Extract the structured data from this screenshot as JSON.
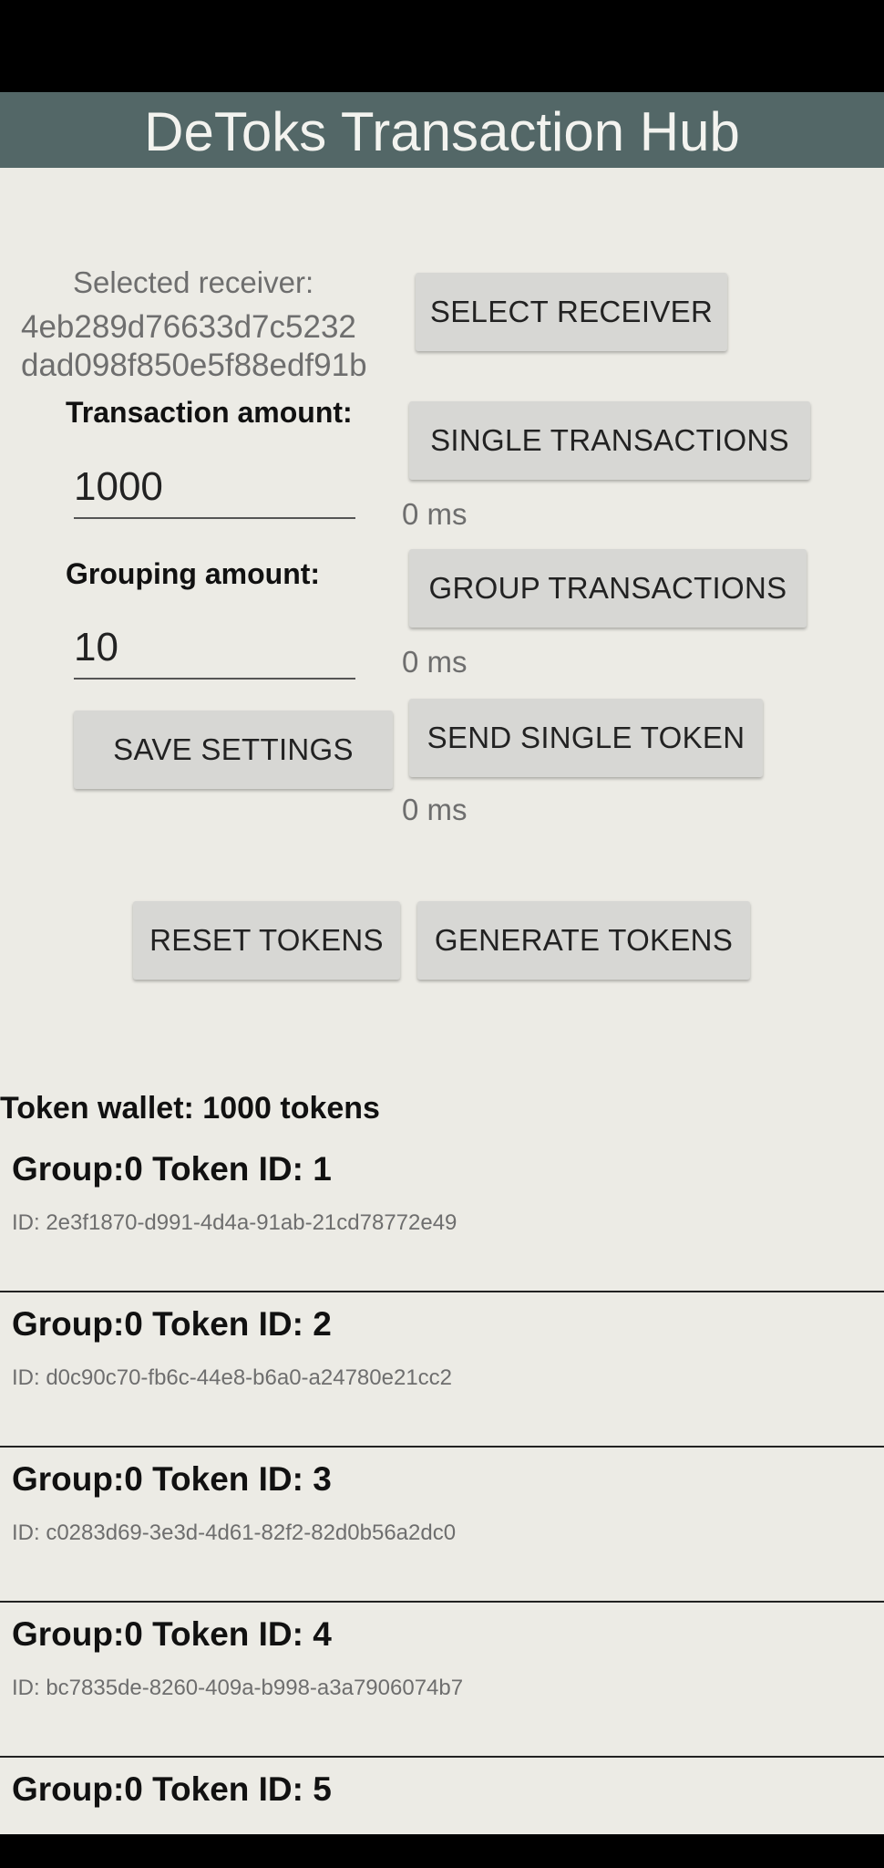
{
  "app": {
    "title": "DeToks Transaction Hub"
  },
  "receiver": {
    "label": "Selected receiver:",
    "line1": "4eb289d76633d7c5232",
    "line2": "dad098f850e5f88edf91b",
    "select_button": "SELECT RECEIVER"
  },
  "transaction": {
    "label": "Transaction amount:",
    "value": "1000",
    "button": "SINGLE TRANSACTIONS",
    "time": "0 ms"
  },
  "grouping": {
    "label": "Grouping amount:",
    "value": "10",
    "button": "GROUP TRANSACTIONS",
    "time": "0 ms"
  },
  "save_button": "SAVE SETTINGS",
  "single_token": {
    "button": "SEND SINGLE TOKEN",
    "time": "0 ms"
  },
  "reset_button": "RESET TOKENS",
  "generate_button": "GENERATE TOKENS",
  "wallet": {
    "title": "Token wallet: 1000 tokens",
    "tokens": [
      {
        "title": "Group:0 Token ID: 1",
        "id": "ID: 2e3f1870-d991-4d4a-91ab-21cd78772e49"
      },
      {
        "title": "Group:0 Token ID: 2",
        "id": "ID: d0c90c70-fb6c-44e8-b6a0-a24780e21cc2"
      },
      {
        "title": "Group:0 Token ID: 3",
        "id": "ID: c0283d69-3e3d-4d61-82f2-82d0b56a2dc0"
      },
      {
        "title": "Group:0 Token ID: 4",
        "id": "ID: bc7835de-8260-409a-b998-a3a7906074b7"
      },
      {
        "title": "Group:0 Token ID: 5",
        "id": ""
      }
    ]
  }
}
